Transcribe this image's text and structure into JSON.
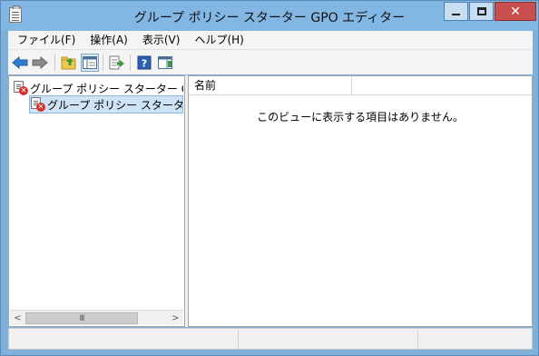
{
  "window": {
    "title": "グループ ポリシー スターター GPO エディター",
    "close_glyph": "✕"
  },
  "menu": [
    {
      "label": "ファイル(F)"
    },
    {
      "label": "操作(A)"
    },
    {
      "label": "表示(V)"
    },
    {
      "label": "ヘルプ(H)"
    }
  ],
  "toolbar": {
    "icons": [
      "back-arrow-icon",
      "forward-arrow-icon",
      "up-folder-icon",
      "show-hide-tree-icon",
      "export-list-icon",
      "help-icon",
      "show-hide-action-pane-icon"
    ]
  },
  "tree": {
    "root_label": "グループ ポリシー スターター GPO エディター",
    "child_label": "グループ ポリシー スターター GPO"
  },
  "list": {
    "column_name": "名前",
    "empty_message": "このビューに表示する項目はありません。"
  },
  "scrollbar": {
    "left_arrow": "<",
    "right_arrow": ">",
    "thumb_grip": "III"
  },
  "colors": {
    "titlebar": "#82b7e3",
    "close_button": "#c7504f",
    "selection": "#cfe3f6",
    "back_arrow": "#2f7dd1",
    "forward_arrow": "#7a7a7a"
  }
}
